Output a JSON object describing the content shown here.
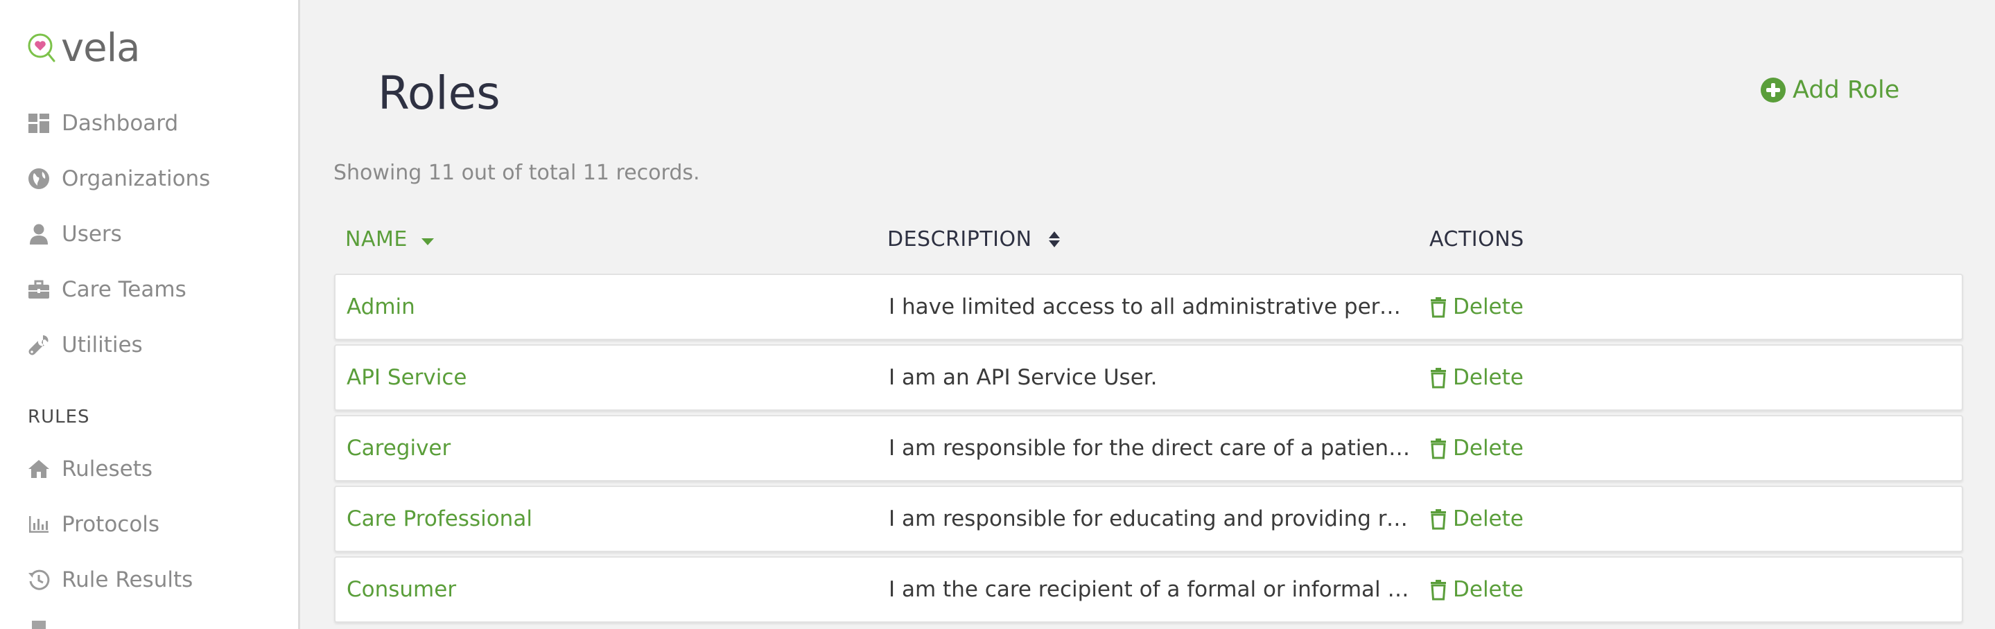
{
  "app": {
    "logo_text": "vela",
    "brand_color": "#5a9e3a"
  },
  "sidebar": {
    "items": [
      {
        "label": "Dashboard",
        "icon": "dashboard-icon"
      },
      {
        "label": "Organizations",
        "icon": "globe-icon"
      },
      {
        "label": "Users",
        "icon": "user-icon"
      },
      {
        "label": "Care Teams",
        "icon": "briefcase-icon"
      },
      {
        "label": "Utilities",
        "icon": "wrench-icon"
      }
    ],
    "rules_section": "RULES",
    "rules_items": [
      {
        "label": "Rulesets",
        "icon": "home-icon"
      },
      {
        "label": "Protocols",
        "icon": "bar-chart-icon"
      },
      {
        "label": "Rule Results",
        "icon": "history-icon"
      }
    ]
  },
  "main": {
    "title": "Roles",
    "add_button": "Add Role",
    "records_info": "Showing 11 out of total 11 records.",
    "columns": {
      "name": "NAME",
      "description": "DESCRIPTION",
      "actions": "ACTIONS"
    },
    "rows": [
      {
        "name": "Admin",
        "description": "I have limited access to all administrative permissio...",
        "action": "Delete"
      },
      {
        "name": "API Service",
        "description": "I am an API Service User.",
        "action": "Delete"
      },
      {
        "name": "Caregiver",
        "description": "I am responsible for the direct care of a patient wh...",
        "action": "Delete"
      },
      {
        "name": "Care Professional",
        "description": "I am responsible for educating and providing resou...",
        "action": "Delete"
      },
      {
        "name": "Consumer",
        "description": "I am the care recipient of a formal or informal careg...",
        "action": "Delete"
      }
    ]
  }
}
